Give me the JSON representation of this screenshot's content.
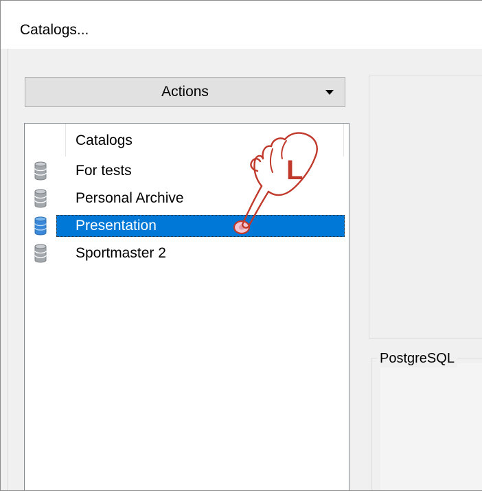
{
  "window": {
    "title": "Catalogs..."
  },
  "actions": {
    "label": "Actions"
  },
  "catalog_list": {
    "header": "Catalogs",
    "items": [
      {
        "label": "For tests",
        "icon": "database-icon",
        "selected": false
      },
      {
        "label": "Personal Archive",
        "icon": "database-icon",
        "selected": false
      },
      {
        "label": "Presentation",
        "icon": "database-icon",
        "selected": true
      },
      {
        "label": "Sportmaster 2",
        "icon": "database-icon",
        "selected": false
      }
    ]
  },
  "details": {
    "group_title": "PostgreSQL"
  },
  "pointer": {
    "letter": "L",
    "meaning": "left-click-hand-icon"
  },
  "colors": {
    "selection": "#0078d7",
    "pointer_outline": "#c0392b",
    "db_icon_gray": "#9ea3a8",
    "db_icon_blue": "#3b88d8"
  }
}
